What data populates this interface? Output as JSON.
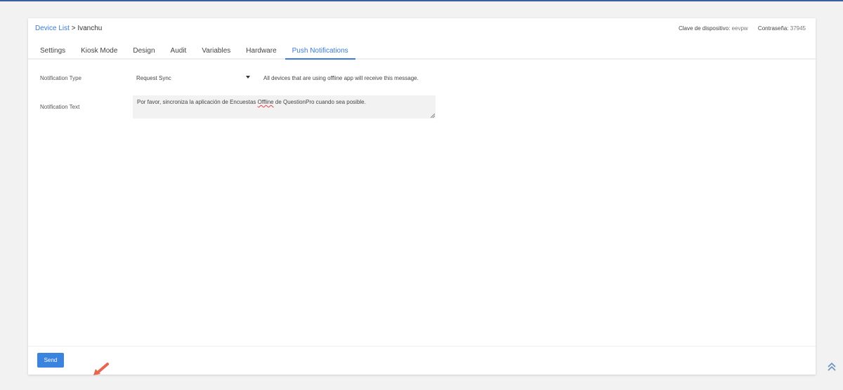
{
  "breadcrumb": {
    "parent": "Device List",
    "separator": ">",
    "current": "Ivanchu"
  },
  "meta": {
    "device_key_label": "Clave de dispositivo:",
    "device_key": "eevpw",
    "password_label": "Contraseña:",
    "password": "37945"
  },
  "tabs": [
    {
      "label": "Settings"
    },
    {
      "label": "Kiosk Mode"
    },
    {
      "label": "Design"
    },
    {
      "label": "Audit"
    },
    {
      "label": "Variables"
    },
    {
      "label": "Hardware"
    },
    {
      "label": "Push Notifications",
      "active": true
    }
  ],
  "form": {
    "type_label": "Notification Type",
    "type_value": "Request Sync",
    "type_hint": "All devices that are using offline app will receive this message.",
    "text_label": "Notification Text",
    "text_before": "Por favor, sincroniza la aplicación de Encuestas ",
    "text_misspelled": "Offline",
    "text_after": " de QuestionPro cuando sea posible."
  },
  "send_label": "Send",
  "colors": {
    "accent": "#3a7bd5",
    "button": "#3a84e0",
    "arrow": "#e8664f"
  }
}
